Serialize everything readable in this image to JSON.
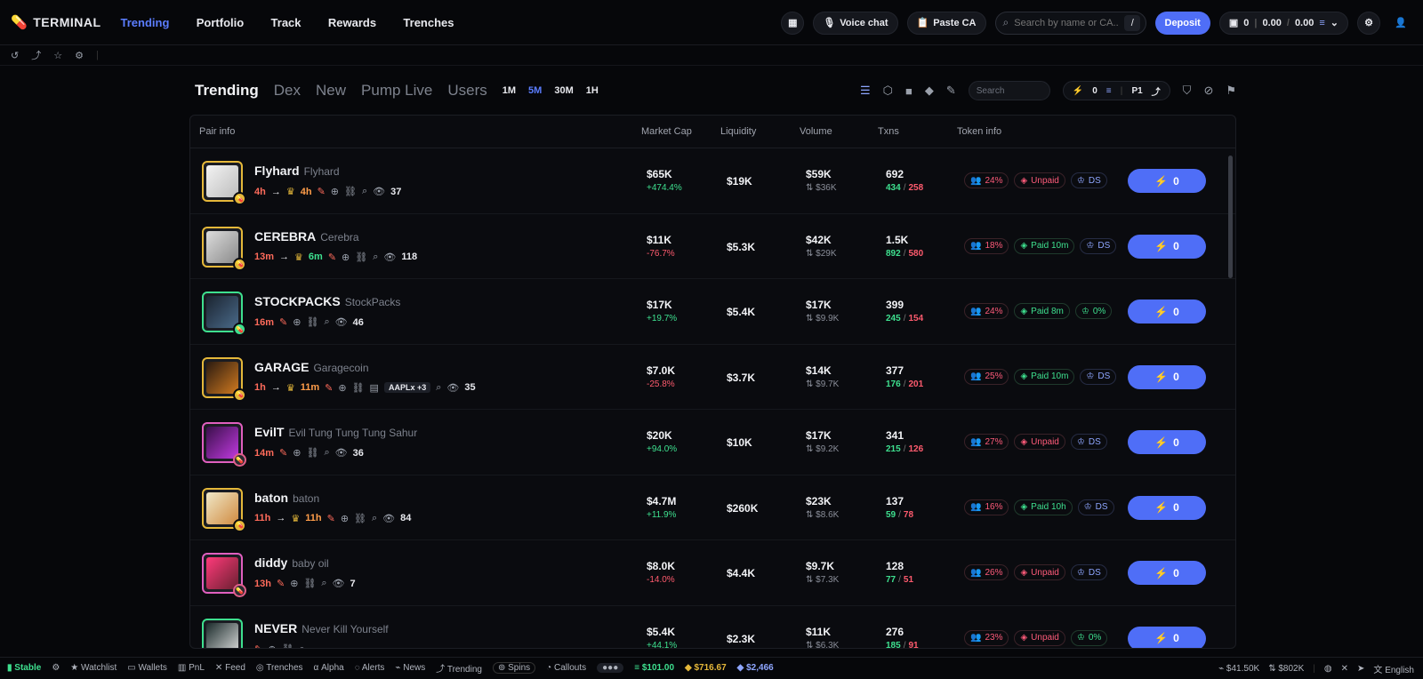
{
  "topbar": {
    "logo": "TERMINAL",
    "nav": [
      "Trending",
      "Portfolio",
      "Track",
      "Rewards",
      "Trenches"
    ],
    "voice_chat": "Voice chat",
    "paste_ca": "Paste CA",
    "search_placeholder": "Search by name or CA...",
    "search_kbd": "/",
    "deposit": "Deposit",
    "wallet_count": "0",
    "wallet_a": "0.00",
    "wallet_sep": "/",
    "wallet_b": "0.00"
  },
  "tabs": [
    "Trending",
    "Dex",
    "New",
    "Pump Live",
    "Users"
  ],
  "timeframes": [
    "1M",
    "5M",
    "30M",
    "1H"
  ],
  "tools": {
    "search_placeholder": "Search",
    "quick_amount": "0",
    "preset": "P1"
  },
  "table": {
    "headers": [
      "Pair info",
      "Market Cap",
      "Liquidity",
      "Volume",
      "Txns",
      "Token info"
    ],
    "buy_label": "0",
    "rows": [
      {
        "symbol": "Flyhard",
        "name": "Flyhard",
        "age": "4h",
        "arrow": "→",
        "crown": "4h",
        "views": "37",
        "mc": "$65K",
        "change": "+474.4%",
        "liq": "$19K",
        "vol": "$59K",
        "vol2": "$36K",
        "tx": "692",
        "buys": "434",
        "sells": "258",
        "holders": "24%",
        "paid": "Unpaid",
        "ds": "DS"
      },
      {
        "symbol": "CEREBRA",
        "name": "Cerebra",
        "age": "13m",
        "arrow": "→",
        "crown": "6m",
        "views": "118",
        "mc": "$11K",
        "change": "-76.7%",
        "liq": "$5.3K",
        "vol": "$42K",
        "vol2": "$29K",
        "tx": "1.5K",
        "buys": "892",
        "sells": "580",
        "holders": "18%",
        "paid": "Paid 10m",
        "ds": "DS"
      },
      {
        "symbol": "STOCKPACKS",
        "name": "StockPacks",
        "age": "16m",
        "arrow": "",
        "crown": "",
        "views": "46",
        "mc": "$17K",
        "change": "+19.7%",
        "liq": "$5.4K",
        "vol": "$17K",
        "vol2": "$9.9K",
        "tx": "399",
        "buys": "245",
        "sells": "154",
        "holders": "24%",
        "paid": "Paid 8m",
        "ds": "0%"
      },
      {
        "symbol": "GARAGE",
        "name": "Garagecoin",
        "age": "1h",
        "arrow": "→",
        "crown": "11m",
        "views": "35",
        "tag": "AAPLx +3",
        "mc": "$7.0K",
        "change": "-25.8%",
        "liq": "$3.7K",
        "vol": "$14K",
        "vol2": "$9.7K",
        "tx": "377",
        "buys": "176",
        "sells": "201",
        "holders": "25%",
        "paid": "Paid 10m",
        "ds": "DS"
      },
      {
        "symbol": "EvilT",
        "name": "Evil Tung Tung Tung Sahur",
        "age": "14m",
        "arrow": "",
        "crown": "",
        "views": "36",
        "mc": "$20K",
        "change": "+94.0%",
        "liq": "$10K",
        "vol": "$17K",
        "vol2": "$9.2K",
        "tx": "341",
        "buys": "215",
        "sells": "126",
        "holders": "27%",
        "paid": "Unpaid",
        "ds": "DS"
      },
      {
        "symbol": "baton",
        "name": "baton",
        "age": "11h",
        "arrow": "→",
        "crown": "11h",
        "views": "84",
        "mc": "$4.7M",
        "change": "+11.9%",
        "liq": "$260K",
        "vol": "$23K",
        "vol2": "$8.6K",
        "tx": "137",
        "buys": "59",
        "sells": "78",
        "holders": "16%",
        "paid": "Paid 10h",
        "ds": "DS"
      },
      {
        "symbol": "diddy",
        "name": "baby oil",
        "age": "13h",
        "arrow": "",
        "crown": "",
        "views": "7",
        "mc": "$8.0K",
        "change": "-14.0%",
        "liq": "$4.4K",
        "vol": "$9.7K",
        "vol2": "$7.3K",
        "tx": "128",
        "buys": "77",
        "sells": "51",
        "holders": "26%",
        "paid": "Unpaid",
        "ds": "DS"
      },
      {
        "symbol": "NEVER",
        "name": "Never Kill Yourself",
        "age": "",
        "arrow": "",
        "crown": "",
        "views": "",
        "mc": "$5.4K",
        "change": "+44.1%",
        "liq": "$2.3K",
        "vol": "$11K",
        "vol2": "$6.3K",
        "tx": "276",
        "buys": "185",
        "sells": "91",
        "holders": "23%",
        "paid": "Unpaid",
        "ds": "0%"
      }
    ]
  },
  "footer": {
    "stable": "Stable",
    "items": [
      "Watchlist",
      "Wallets",
      "PnL",
      "Feed",
      "Trenches",
      "Alpha",
      "Alerts",
      "News",
      "Trending",
      "Spins",
      "Callouts"
    ],
    "sol_price": "$101.00",
    "bnb_price": "$716.67",
    "eth_price": "$2,466",
    "right_a": "$41.50K",
    "right_b": "$802K",
    "language": "English"
  }
}
